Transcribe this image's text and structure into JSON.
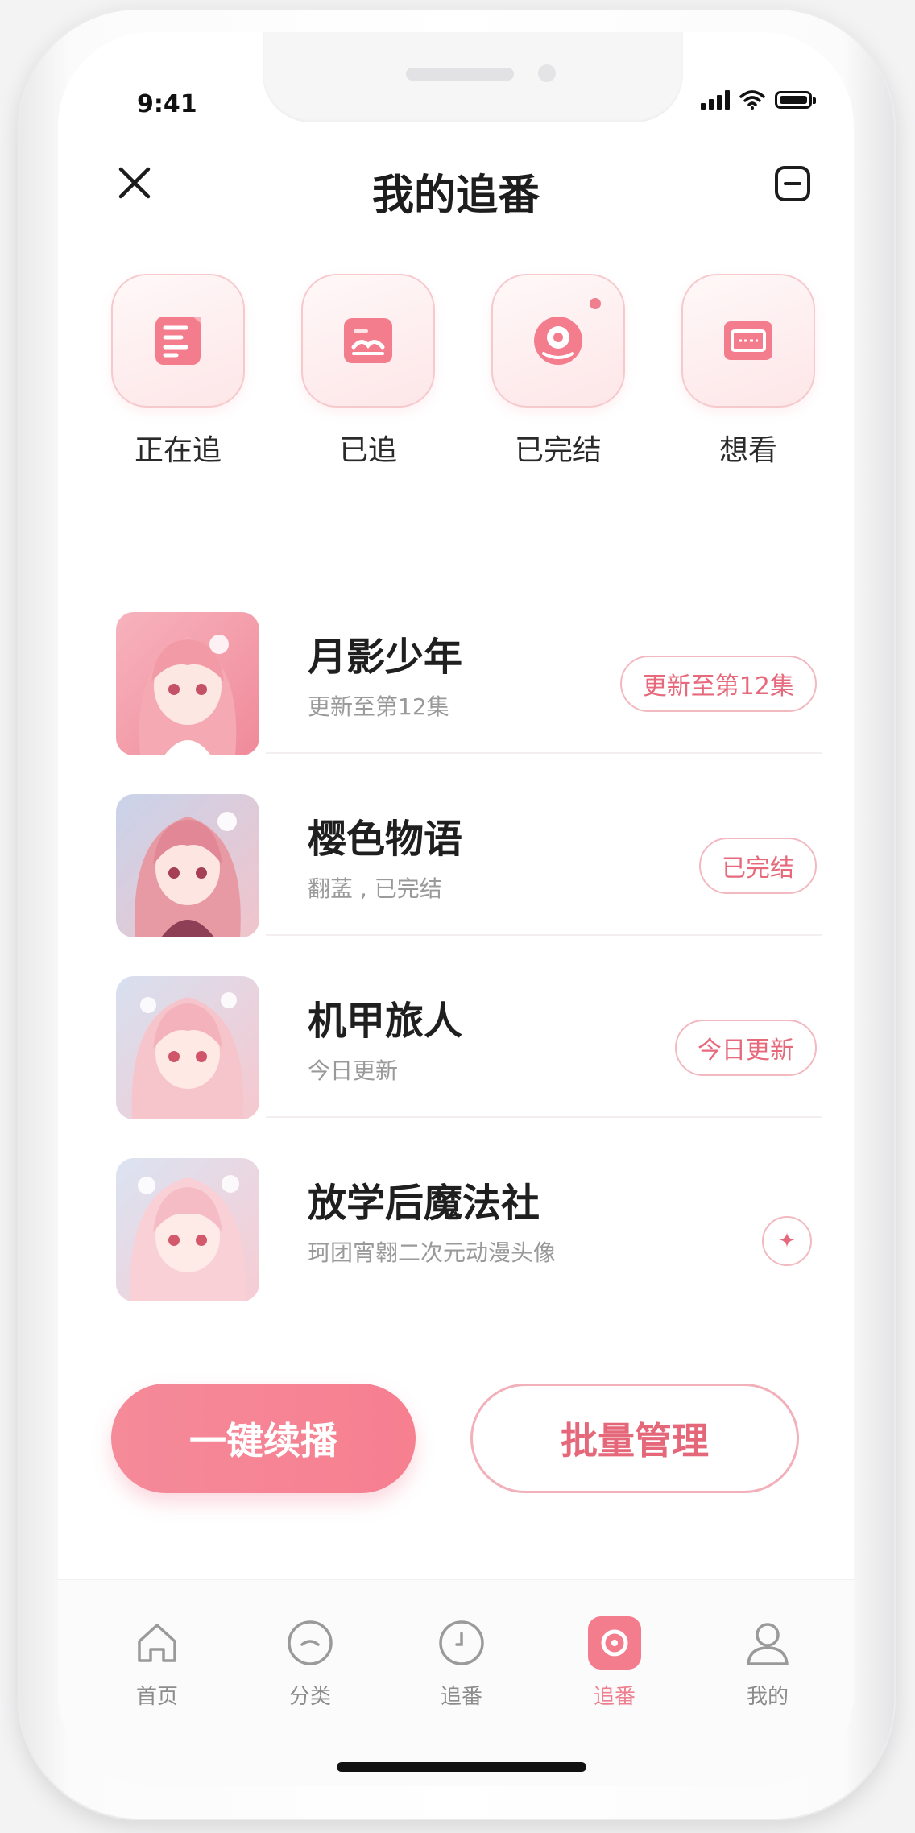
{
  "status_bar": {
    "time": "9:41",
    "battery_level": 1.0
  },
  "header": {
    "title": "我的追番"
  },
  "categories": [
    {
      "label": "正在追",
      "icon": "note-icon"
    },
    {
      "label": "已追",
      "icon": "book-icon"
    },
    {
      "label": "已完结",
      "icon": "disc-icon"
    },
    {
      "label": "想看",
      "icon": "ticket-icon"
    }
  ],
  "shows": [
    {
      "title": "月影少年",
      "subtitle": "更新至第12集",
      "tag": "更新至第12集"
    },
    {
      "title": "樱色物语",
      "subtitle": "翻䓝 , 已完结",
      "tag": "已完结"
    },
    {
      "title": "机甲旅人",
      "subtitle": "今日更新",
      "tag": "今日更新"
    },
    {
      "title": "放学后魔法社",
      "subtitle": "珂团宵翱二次元动漫头像",
      "tag": ""
    }
  ],
  "actions": {
    "primary": "一键续播",
    "secondary": "批量管理"
  },
  "tabbar": [
    {
      "label": "首页",
      "icon": "home-icon",
      "active": false
    },
    {
      "label": "分类",
      "icon": "category-icon",
      "active": false
    },
    {
      "label": "追番",
      "icon": "clock-icon",
      "active": false
    },
    {
      "label": "追番",
      "icon": "tracking-icon",
      "active": true
    },
    {
      "label": "我的",
      "icon": "profile-icon",
      "active": false
    }
  ],
  "colors": {
    "accent": "#f58a99",
    "accent_text": "#e66a7c",
    "tag_border": "#f2b9c1"
  }
}
